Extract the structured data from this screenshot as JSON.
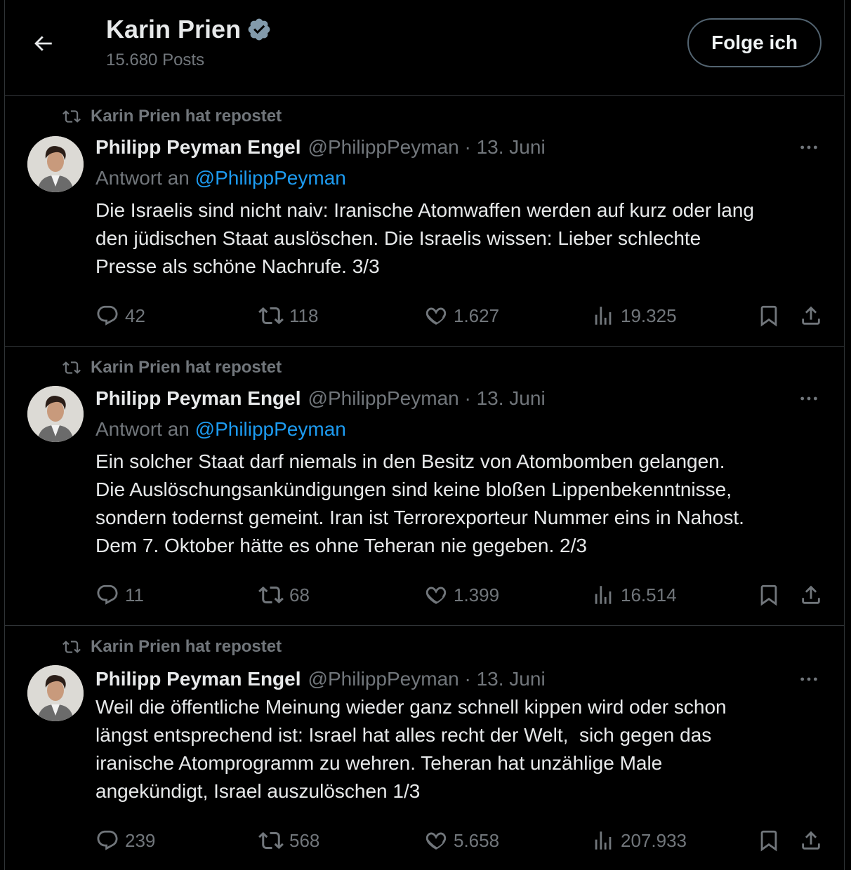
{
  "header": {
    "title": "Karin Prien",
    "posts_count": "15.680 Posts",
    "follow_label": "Folge ich"
  },
  "tweets": [
    {
      "repost_label": "Karin Prien hat repostet",
      "author": "Philipp Peyman Engel",
      "handle": "@PhilippPeyman · 13. Juni",
      "reply_prefix": "Antwort an",
      "reply_to": "@PhilippPeyman",
      "text": "Die Israelis sind nicht naiv: Iranische Atomwaffen werden auf kurz oder lang\nden jüdischen Staat auslöschen. Die Israelis wissen: Lieber schlechte\nPresse als schöne Nachrufe. 3/3",
      "replies": "42",
      "reposts": "118",
      "likes": "1.627",
      "views": "19.325"
    },
    {
      "repost_label": "Karin Prien hat repostet",
      "author": "Philipp Peyman Engel",
      "handle": "@PhilippPeyman · 13. Juni",
      "reply_prefix": "Antwort an",
      "reply_to": "@PhilippPeyman",
      "text": "Ein solcher Staat darf niemals in den Besitz von Atombomben gelangen.\nDie Auslöschungsankündigungen sind keine bloßen Lippenbekenntnisse,\nsondern todernst gemeint. Iran ist Terrorexporteur Nummer eins in Nahost.\nDem 7. Oktober hätte es ohne Teheran nie gegeben. 2/3",
      "replies": "11",
      "reposts": "68",
      "likes": "1.399",
      "views": "16.514"
    },
    {
      "repost_label": "Karin Prien hat repostet",
      "author": "Philipp Peyman Engel",
      "handle": "@PhilippPeyman · 13. Juni",
      "text": "Weil die öffentliche Meinung wieder ganz schnell kippen wird oder schon\nlängst entsprechend ist: Israel hat alles recht der Welt,  sich gegen das\niranische Atomprogramm zu wehren. Teheran hat unzählige Male\nangekündigt, Israel auszulöschen 1/3",
      "replies": "239",
      "reposts": "568",
      "likes": "5.658",
      "views": "207.933"
    }
  ],
  "icons": {
    "back": "arrow-left-icon",
    "verified": "verified-badge-icon",
    "repost": "repost-icon",
    "more": "more-horizontal-icon",
    "reply": "reply-icon",
    "like": "heart-icon",
    "views": "views-chart-icon",
    "bookmark": "bookmark-icon",
    "share": "share-icon"
  },
  "colors": {
    "background": "#000000",
    "text": "#e7e9ea",
    "muted": "#71767b",
    "link": "#1d9bf0",
    "border": "#2f3336"
  }
}
